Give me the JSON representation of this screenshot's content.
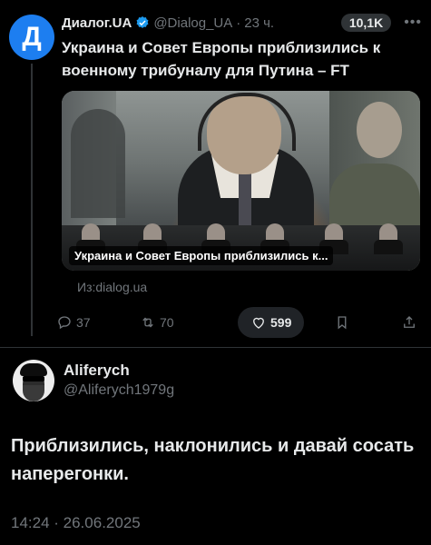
{
  "quoted_tweet": {
    "avatar_letter": "Д",
    "author_name": "Диалог.UA",
    "handle": "@Dialog_UA",
    "separator": "·",
    "time": "23 ч.",
    "views_badge": "10,1K",
    "text": "Украина и Совет Европы приблизились к военному трибуналу для Путина – FT",
    "media_caption": "Украина и Совет Европы приблизились к...",
    "source": "Из:dialog.ua",
    "actions": {
      "replies": "37",
      "retweets": "70",
      "likes": "599"
    }
  },
  "reply_tweet": {
    "author_name": "Aliferych",
    "handle": "@Aliferych1979g",
    "text": "Приблизились, наклонились и давай сосать наперегонки.",
    "timestamp": "14:24 · 26.06.2025"
  },
  "colors": {
    "background": "#000000",
    "text": "#e7e9ea",
    "muted": "#71767b",
    "accent": "#1d9bf0",
    "dialog_brand": "#1d7ef0"
  },
  "icons": [
    "verified-icon",
    "more-icon",
    "reply-icon",
    "retweet-icon",
    "like-icon",
    "bookmark-icon",
    "share-icon"
  ]
}
